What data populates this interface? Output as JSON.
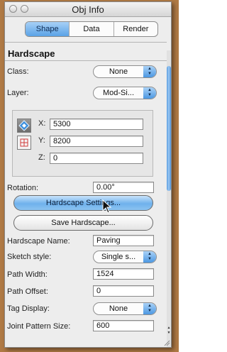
{
  "window": {
    "title": "Obj Info"
  },
  "tabs": [
    {
      "label": "Shape",
      "active": true
    },
    {
      "label": "Data",
      "active": false
    },
    {
      "label": "Render",
      "active": false
    }
  ],
  "section": {
    "title": "Hardscape"
  },
  "class": {
    "label": "Class:",
    "value": "None"
  },
  "layer": {
    "label": "Layer:",
    "value": "Mod-Si..."
  },
  "coords": {
    "x": {
      "label": "X:",
      "value": "5300"
    },
    "y": {
      "label": "Y:",
      "value": "8200"
    },
    "z": {
      "label": "Z:",
      "value": "0"
    }
  },
  "rotation": {
    "label": "Rotation:",
    "value": "0.00°"
  },
  "buttons": {
    "settings": "Hardscape Settings...",
    "save": "Save Hardscape..."
  },
  "hardscape_name": {
    "label": "Hardscape Name:",
    "value": "Paving"
  },
  "sketch_style": {
    "label": "Sketch style:",
    "value": "Single s..."
  },
  "path_width": {
    "label": "Path Width:",
    "value": "1524"
  },
  "path_offset": {
    "label": "Path Offset:",
    "value": "0"
  },
  "tag_display": {
    "label": "Tag Display:",
    "value": "None"
  },
  "joint_pattern_size": {
    "label": "Joint Pattern Size:",
    "value": "600"
  },
  "colors": {
    "accent": "#5aa2e6",
    "frame": "#b07a45"
  }
}
